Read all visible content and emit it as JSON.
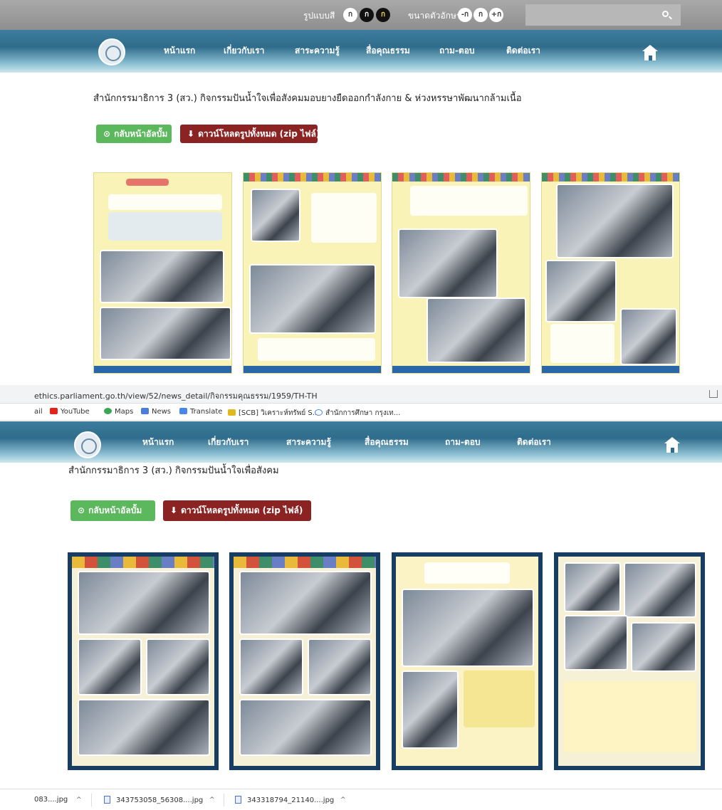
{
  "topbar": {
    "style_label": "รูปแบบสี",
    "style_opts": [
      "ก",
      "ก",
      "ก"
    ],
    "size_label": "ขนาดตัวอักษร",
    "size_opts": [
      "-ก",
      "ก",
      "+ก"
    ]
  },
  "nav": {
    "items": [
      "หน้าแรก",
      "เกี่ยวกับเรา",
      "สาระความรู้",
      "สื่อคุณธรรม",
      "ถาม-ตอบ",
      "ติดต่อเรา"
    ]
  },
  "page1": {
    "title": "สำนักกรรมาธิการ 3 (สว.) กิจกรรมปันน้ำใจเพื่อสังคมมอบยางยืดออกกำลังกาย & ห่วงหรรษาพัฒนากล้ามเนื้อ",
    "back_label": "กลับหน้าอัลบั้ม",
    "download_label": "ดาวน์โหลดรูปทั้งหมด (zip ไฟล์)"
  },
  "browser": {
    "url": "ethics.parliament.go.th/view/52/news_detail/กิจกรรมคุณธรรม/1959/TH-TH",
    "bookmarks": [
      "ail",
      "YouTube",
      "Maps",
      "News",
      "Translate",
      "[SCB] วิเคราะห์ทรัพย์ S...",
      "สำนักการศึกษา กรุงเท..."
    ]
  },
  "page2": {
    "title": "สำนักกรรมาธิการ 3 (สว.) กิจกรรมปันน้ำใจเพื่อสังคม",
    "back_label": "กลับหน้าอัลบั้ม",
    "download_label": "ดาวน์โหลดรูปทั้งหมด (zip ไฟล์)"
  },
  "downloads": [
    "083....jpg",
    "343753058_56308....jpg",
    "343318794_21140....jpg"
  ]
}
